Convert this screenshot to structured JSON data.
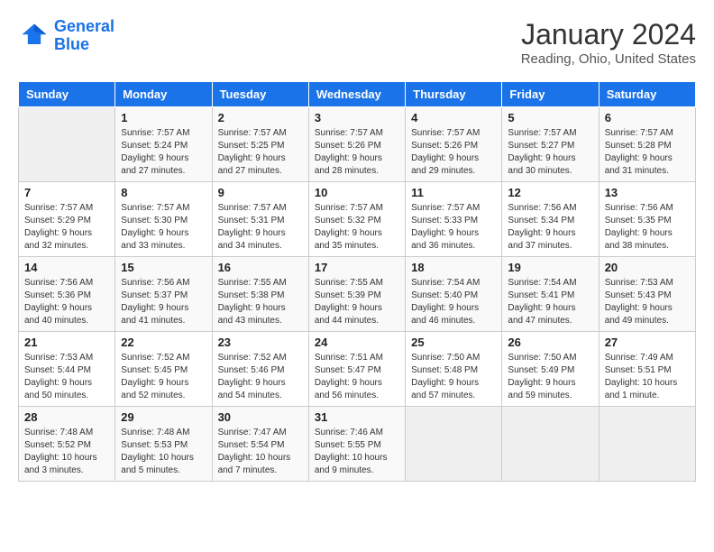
{
  "header": {
    "logo_line1": "General",
    "logo_line2": "Blue",
    "month": "January 2024",
    "location": "Reading, Ohio, United States"
  },
  "columns": [
    "Sunday",
    "Monday",
    "Tuesday",
    "Wednesday",
    "Thursday",
    "Friday",
    "Saturday"
  ],
  "weeks": [
    [
      {
        "day": "",
        "sunrise": "",
        "sunset": "",
        "daylight": "",
        "empty": true
      },
      {
        "day": "1",
        "sunrise": "Sunrise: 7:57 AM",
        "sunset": "Sunset: 5:24 PM",
        "daylight": "Daylight: 9 hours and 27 minutes."
      },
      {
        "day": "2",
        "sunrise": "Sunrise: 7:57 AM",
        "sunset": "Sunset: 5:25 PM",
        "daylight": "Daylight: 9 hours and 27 minutes."
      },
      {
        "day": "3",
        "sunrise": "Sunrise: 7:57 AM",
        "sunset": "Sunset: 5:26 PM",
        "daylight": "Daylight: 9 hours and 28 minutes."
      },
      {
        "day": "4",
        "sunrise": "Sunrise: 7:57 AM",
        "sunset": "Sunset: 5:26 PM",
        "daylight": "Daylight: 9 hours and 29 minutes."
      },
      {
        "day": "5",
        "sunrise": "Sunrise: 7:57 AM",
        "sunset": "Sunset: 5:27 PM",
        "daylight": "Daylight: 9 hours and 30 minutes."
      },
      {
        "day": "6",
        "sunrise": "Sunrise: 7:57 AM",
        "sunset": "Sunset: 5:28 PM",
        "daylight": "Daylight: 9 hours and 31 minutes."
      }
    ],
    [
      {
        "day": "7",
        "sunrise": "Sunrise: 7:57 AM",
        "sunset": "Sunset: 5:29 PM",
        "daylight": "Daylight: 9 hours and 32 minutes."
      },
      {
        "day": "8",
        "sunrise": "Sunrise: 7:57 AM",
        "sunset": "Sunset: 5:30 PM",
        "daylight": "Daylight: 9 hours and 33 minutes."
      },
      {
        "day": "9",
        "sunrise": "Sunrise: 7:57 AM",
        "sunset": "Sunset: 5:31 PM",
        "daylight": "Daylight: 9 hours and 34 minutes."
      },
      {
        "day": "10",
        "sunrise": "Sunrise: 7:57 AM",
        "sunset": "Sunset: 5:32 PM",
        "daylight": "Daylight: 9 hours and 35 minutes."
      },
      {
        "day": "11",
        "sunrise": "Sunrise: 7:57 AM",
        "sunset": "Sunset: 5:33 PM",
        "daylight": "Daylight: 9 hours and 36 minutes."
      },
      {
        "day": "12",
        "sunrise": "Sunrise: 7:56 AM",
        "sunset": "Sunset: 5:34 PM",
        "daylight": "Daylight: 9 hours and 37 minutes."
      },
      {
        "day": "13",
        "sunrise": "Sunrise: 7:56 AM",
        "sunset": "Sunset: 5:35 PM",
        "daylight": "Daylight: 9 hours and 38 minutes."
      }
    ],
    [
      {
        "day": "14",
        "sunrise": "Sunrise: 7:56 AM",
        "sunset": "Sunset: 5:36 PM",
        "daylight": "Daylight: 9 hours and 40 minutes."
      },
      {
        "day": "15",
        "sunrise": "Sunrise: 7:56 AM",
        "sunset": "Sunset: 5:37 PM",
        "daylight": "Daylight: 9 hours and 41 minutes."
      },
      {
        "day": "16",
        "sunrise": "Sunrise: 7:55 AM",
        "sunset": "Sunset: 5:38 PM",
        "daylight": "Daylight: 9 hours and 43 minutes."
      },
      {
        "day": "17",
        "sunrise": "Sunrise: 7:55 AM",
        "sunset": "Sunset: 5:39 PM",
        "daylight": "Daylight: 9 hours and 44 minutes."
      },
      {
        "day": "18",
        "sunrise": "Sunrise: 7:54 AM",
        "sunset": "Sunset: 5:40 PM",
        "daylight": "Daylight: 9 hours and 46 minutes."
      },
      {
        "day": "19",
        "sunrise": "Sunrise: 7:54 AM",
        "sunset": "Sunset: 5:41 PM",
        "daylight": "Daylight: 9 hours and 47 minutes."
      },
      {
        "day": "20",
        "sunrise": "Sunrise: 7:53 AM",
        "sunset": "Sunset: 5:43 PM",
        "daylight": "Daylight: 9 hours and 49 minutes."
      }
    ],
    [
      {
        "day": "21",
        "sunrise": "Sunrise: 7:53 AM",
        "sunset": "Sunset: 5:44 PM",
        "daylight": "Daylight: 9 hours and 50 minutes."
      },
      {
        "day": "22",
        "sunrise": "Sunrise: 7:52 AM",
        "sunset": "Sunset: 5:45 PM",
        "daylight": "Daylight: 9 hours and 52 minutes."
      },
      {
        "day": "23",
        "sunrise": "Sunrise: 7:52 AM",
        "sunset": "Sunset: 5:46 PM",
        "daylight": "Daylight: 9 hours and 54 minutes."
      },
      {
        "day": "24",
        "sunrise": "Sunrise: 7:51 AM",
        "sunset": "Sunset: 5:47 PM",
        "daylight": "Daylight: 9 hours and 56 minutes."
      },
      {
        "day": "25",
        "sunrise": "Sunrise: 7:50 AM",
        "sunset": "Sunset: 5:48 PM",
        "daylight": "Daylight: 9 hours and 57 minutes."
      },
      {
        "day": "26",
        "sunrise": "Sunrise: 7:50 AM",
        "sunset": "Sunset: 5:49 PM",
        "daylight": "Daylight: 9 hours and 59 minutes."
      },
      {
        "day": "27",
        "sunrise": "Sunrise: 7:49 AM",
        "sunset": "Sunset: 5:51 PM",
        "daylight": "Daylight: 10 hours and 1 minute."
      }
    ],
    [
      {
        "day": "28",
        "sunrise": "Sunrise: 7:48 AM",
        "sunset": "Sunset: 5:52 PM",
        "daylight": "Daylight: 10 hours and 3 minutes."
      },
      {
        "day": "29",
        "sunrise": "Sunrise: 7:48 AM",
        "sunset": "Sunset: 5:53 PM",
        "daylight": "Daylight: 10 hours and 5 minutes."
      },
      {
        "day": "30",
        "sunrise": "Sunrise: 7:47 AM",
        "sunset": "Sunset: 5:54 PM",
        "daylight": "Daylight: 10 hours and 7 minutes."
      },
      {
        "day": "31",
        "sunrise": "Sunrise: 7:46 AM",
        "sunset": "Sunset: 5:55 PM",
        "daylight": "Daylight: 10 hours and 9 minutes."
      },
      {
        "day": "",
        "sunrise": "",
        "sunset": "",
        "daylight": "",
        "empty": true
      },
      {
        "day": "",
        "sunrise": "",
        "sunset": "",
        "daylight": "",
        "empty": true
      },
      {
        "day": "",
        "sunrise": "",
        "sunset": "",
        "daylight": "",
        "empty": true
      }
    ]
  ]
}
